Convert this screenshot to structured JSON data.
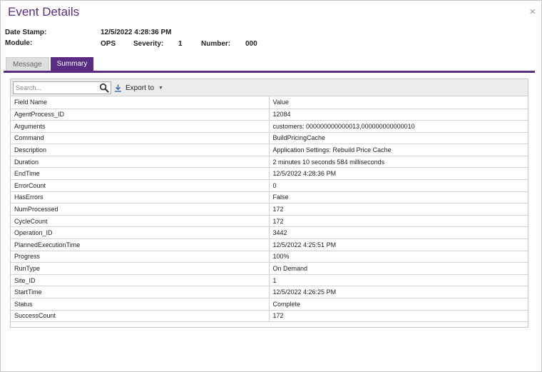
{
  "dialog": {
    "title": "Event Details",
    "close_glyph": "×"
  },
  "meta": {
    "date_stamp_label": "Date Stamp:",
    "date_stamp_value": "12/5/2022 4:28:36 PM",
    "module_label": "Module:",
    "module_value": "OPS",
    "severity_label": "Severity:",
    "severity_value": "1",
    "number_label": "Number:",
    "number_value": "000"
  },
  "tabs": [
    {
      "label": "Message",
      "active": false
    },
    {
      "label": "Summary",
      "active": true
    }
  ],
  "toolbar": {
    "search_placeholder": "Search...",
    "export_label": "Export to",
    "caret": "▼"
  },
  "table": {
    "headers": [
      "Field Name",
      "Value"
    ],
    "rows": [
      [
        "AgentProcess_ID",
        "12084"
      ],
      [
        "Arguments",
        "customers: 000000000000013,000000000000010"
      ],
      [
        "Command",
        "BuildPricingCache"
      ],
      [
        "Description",
        "Application Settings: Rebuild Price Cache"
      ],
      [
        "Duration",
        "2 minutes 10 seconds 584 milliseconds"
      ],
      [
        "EndTime",
        "12/5/2022 4:28:36 PM"
      ],
      [
        "ErrorCount",
        "0"
      ],
      [
        "HasErrors",
        "False"
      ],
      [
        "NumProcessed",
        "172"
      ],
      [
        "CycleCount",
        "172"
      ],
      [
        "Operation_ID",
        "3442"
      ],
      [
        "PlannedExecutionTime",
        "12/5/2022 4:25:51 PM"
      ],
      [
        "Progress",
        "100%"
      ],
      [
        "RunType",
        "On Demand"
      ],
      [
        "Site_ID",
        "1"
      ],
      [
        "StartTime",
        "12/5/2022 4:26:25 PM"
      ],
      [
        "Status",
        "Complete"
      ],
      [
        "SuccessCount",
        "172"
      ]
    ]
  },
  "colors": {
    "accent": "#5a2d82",
    "tab_inactive": "#dedede",
    "export_icon": "#2f6db5"
  }
}
